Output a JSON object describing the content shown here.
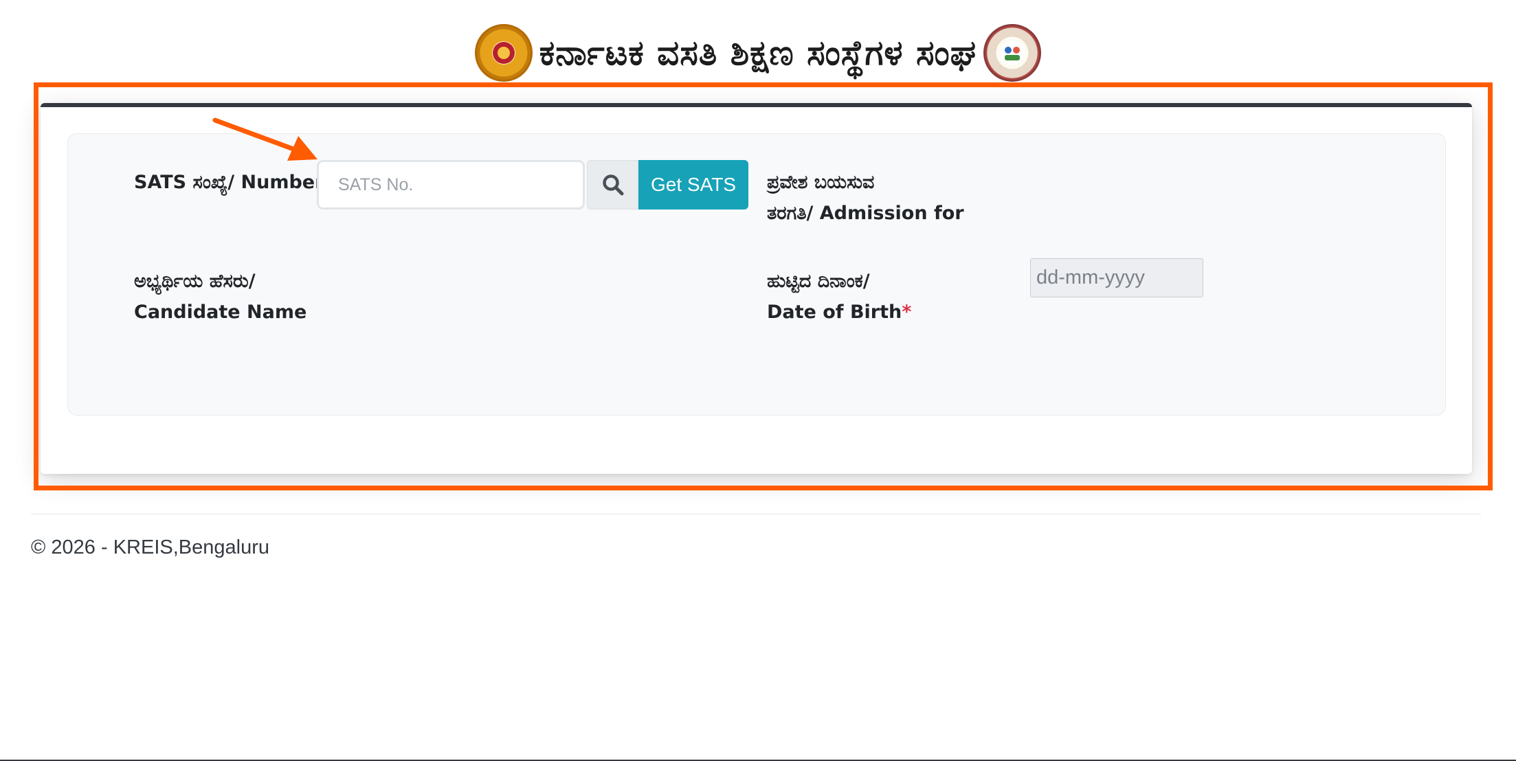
{
  "header": {
    "title": "ಕರ್ನಾಟಕ ವಸತಿ ಶಿಕ್ಷಣ ಸಂಸ್ಥೆಗಳ ಸಂಘ",
    "left_emblem": "karnataka-state-emblem",
    "right_emblem": "kreis-logo"
  },
  "form": {
    "sats_label": "SATS ಸಂಖ್ಯೆ/ Number",
    "required_mark": "*",
    "sats_placeholder": "SATS No.",
    "search_icon": "search-icon",
    "get_sats_button": "Get SATS",
    "admission_label_line1": "ಪ್ರವೇಶ ಬಯಸುವ",
    "admission_label_line2": "ತರಗತಿ/ Admission for",
    "candidate_label_line1": "ಅಭ್ಯರ್ಥಿಯ ಹೆಸರು/",
    "candidate_label_line2": "Candidate Name",
    "dob_label_line1": "ಹುಟ್ಟಿದ ದಿನಾಂಕ/",
    "dob_label_line2": "Date of Birth",
    "dob_placeholder": "dd-mm-yyyy"
  },
  "footer": {
    "text": "© 2026 - KREIS,Bengaluru"
  },
  "colors": {
    "highlight": "#ff5b00",
    "button": "#17a2b8",
    "required": "#dc3545",
    "card_top_border": "#343a40"
  }
}
